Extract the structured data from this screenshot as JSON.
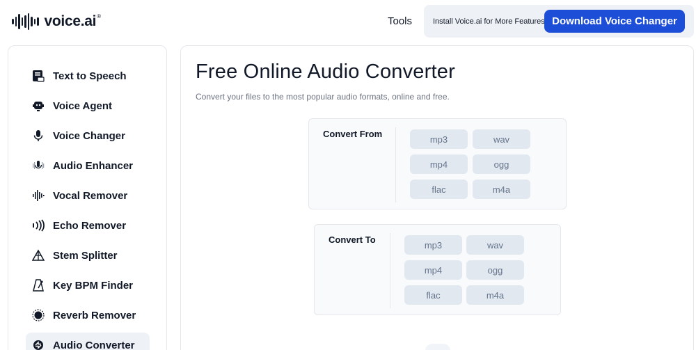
{
  "header": {
    "logo_text": "voice.ai",
    "logo_mark": "®",
    "nav_tools": "Tools",
    "promo_text": "Install Voice.ai for More Features",
    "download_label": "Download Voice Changer",
    "accent_color": "#1d4ed8"
  },
  "sidebar": {
    "items": [
      {
        "label": "Text to Speech",
        "icon": "text-to-speech-icon"
      },
      {
        "label": "Voice Agent",
        "icon": "voice-agent-icon"
      },
      {
        "label": "Voice Changer",
        "icon": "microphone-icon"
      },
      {
        "label": "Audio Enhancer",
        "icon": "audio-enhancer-icon"
      },
      {
        "label": "Vocal Remover",
        "icon": "waveform-icon"
      },
      {
        "label": "Echo Remover",
        "icon": "echo-icon"
      },
      {
        "label": "Stem Splitter",
        "icon": "stem-splitter-icon"
      },
      {
        "label": "Key BPM Finder",
        "icon": "metronome-icon"
      },
      {
        "label": "Reverb Remover",
        "icon": "reverb-icon"
      },
      {
        "label": "Audio Converter",
        "icon": "audio-converter-icon",
        "active": true
      }
    ]
  },
  "main": {
    "title": "Free Online Audio Converter",
    "subtitle": "Convert your files to the most popular audio formats, online and free.",
    "convert_from": {
      "label": "Convert From",
      "formats": [
        "mp3",
        "wav",
        "mp4",
        "ogg",
        "flac",
        "m4a"
      ]
    },
    "convert_to": {
      "label": "Convert To",
      "formats": [
        "mp3",
        "wav",
        "mp4",
        "ogg",
        "flac",
        "m4a"
      ]
    }
  }
}
